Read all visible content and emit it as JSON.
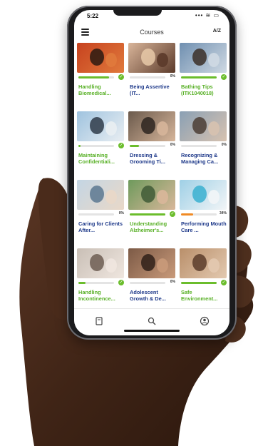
{
  "status": {
    "time": "5:22",
    "icons": "••• ≋ ▭"
  },
  "appbar": {
    "title": "Courses",
    "sort_label": "A/Z"
  },
  "courses": [
    {
      "title": "Handling Biomedical...",
      "progress": 0.85,
      "status": "complete",
      "pct": ""
    },
    {
      "title": "Being Assertive (IT...",
      "progress": 0,
      "status": "percent",
      "pct": "0%"
    },
    {
      "title": "Bathing Tips (ITK1040018)",
      "progress": 1.0,
      "status": "complete",
      "pct": ""
    },
    {
      "title": "Maintaining Confidentiali...",
      "progress": 0.05,
      "status": "complete",
      "pct": ""
    },
    {
      "title": "Dressing & Grooming Ti...",
      "progress": 0.25,
      "status": "percent",
      "pct": "0%"
    },
    {
      "title": "Recognizing & Managing Ca...",
      "progress": 0,
      "status": "percent",
      "pct": "0%"
    },
    {
      "title": "Caring for Clients After...",
      "progress": 0,
      "status": "percent",
      "pct": "0%"
    },
    {
      "title": "Understanding Alzheimer's...",
      "progress": 1.0,
      "status": "complete",
      "pct": ""
    },
    {
      "title": "Performing Mouth Care ...",
      "progress": 0.34,
      "status": "percent",
      "pct": "34%"
    },
    {
      "title": "Handling Incontinence...",
      "progress": 0.2,
      "status": "complete",
      "pct": ""
    },
    {
      "title": "Adolescent Growth & De...",
      "progress": 0,
      "status": "percent",
      "pct": "0%"
    },
    {
      "title": "Safe Environment...",
      "progress": 1.0,
      "status": "complete",
      "pct": ""
    }
  ],
  "colors": {
    "complete_green": "#6bbd2c",
    "title_green": "#58b026",
    "title_blue": "#1f3a8a",
    "partial_orange": "#f08a24"
  },
  "tabbar": {
    "items": [
      "book-icon",
      "search-icon",
      "profile-icon"
    ]
  }
}
